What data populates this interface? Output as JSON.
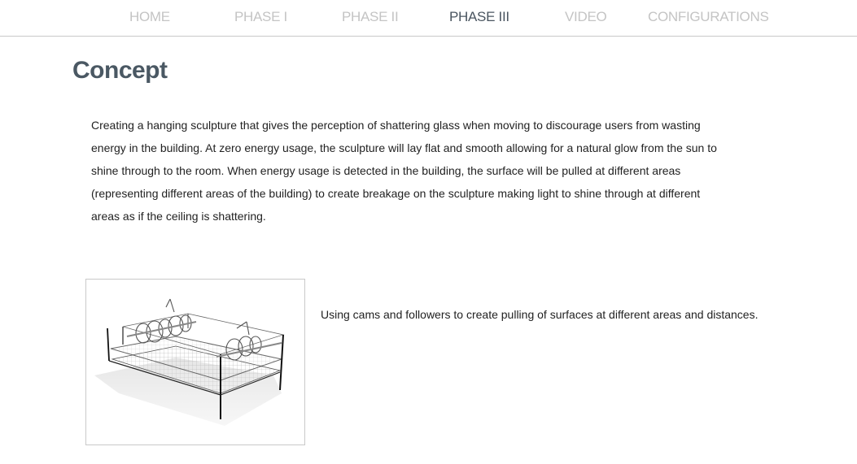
{
  "nav": {
    "items": [
      {
        "label": "HOME",
        "active": false
      },
      {
        "label": "PHASE I",
        "active": false
      },
      {
        "label": "PHASE II",
        "active": false
      },
      {
        "label": "PHASE III",
        "active": true
      },
      {
        "label": "VIDEO",
        "active": false
      },
      {
        "label": "CONFIGURATIONS",
        "active": false
      }
    ],
    "colors": {
      "inactive": "#c4c4c4",
      "active": "#4a5560"
    }
  },
  "page": {
    "title": "Concept",
    "body": "Creating a hanging sculpture that gives the perception of shattering glass when moving to discourage users from wasting energy in the building. At zero energy usage, the sculpture will lay flat and smooth allowing for a natural glow from the sun to shine through to the room. When energy usage is detected in the building, the surface will be pulled at different areas (representing different areas of the building) to create breakage on the sculpture making light to shine through at different areas as if the ceiling is shattering."
  },
  "figure": {
    "caption": "Using cams and followers to create pulling of surfaces at different areas and distances."
  }
}
